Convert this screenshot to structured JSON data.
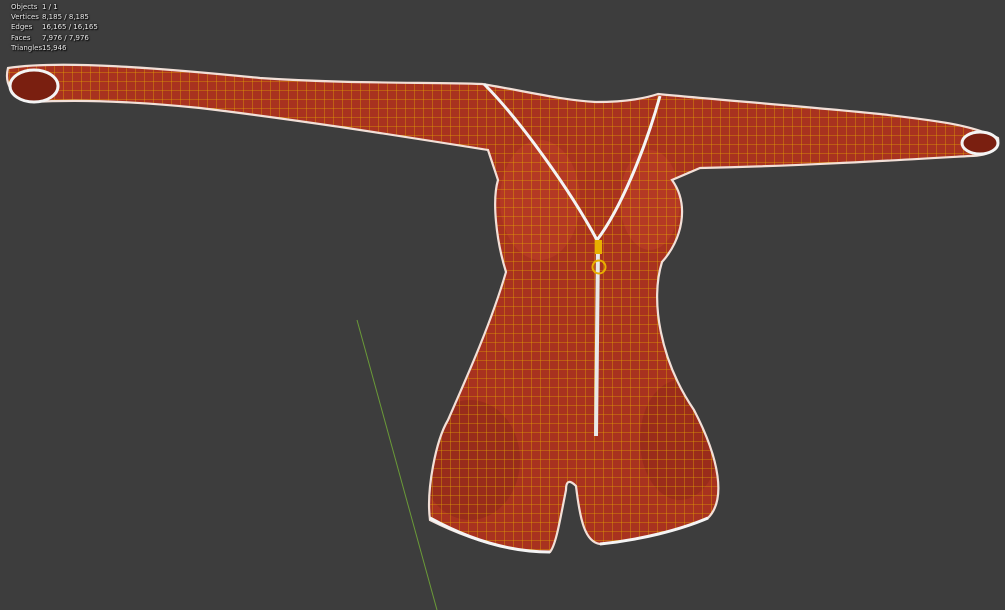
{
  "viewport": {
    "background": "#3d3d3d",
    "object_color": "#a8321f",
    "wireframe_color": "#e8b000",
    "edge_highlight_color": "#ffffff"
  },
  "stats": {
    "objects": {
      "label": "Objects",
      "value": "1 / 1"
    },
    "vertices": {
      "label": "Vertices",
      "value": "8,185 / 8,185"
    },
    "edges": {
      "label": "Edges",
      "value": "16,165 / 16,165"
    },
    "faces": {
      "label": "Faces",
      "value": "7,976 / 7,976"
    },
    "triangles": {
      "label": "Triangles",
      "value": "15,946"
    }
  },
  "scene": {
    "mesh": "romper-mesh",
    "details": [
      "zipper",
      "zipper-pull-ring",
      "y-axis-line"
    ]
  }
}
